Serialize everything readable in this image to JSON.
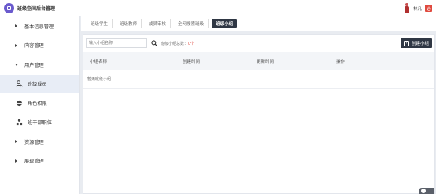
{
  "header": {
    "app_title": "班级空间后台管理",
    "user_name": "林凡"
  },
  "sidebar": {
    "items": [
      {
        "label": "基本信息管理",
        "type": "group",
        "expanded": false
      },
      {
        "label": "内容管理",
        "type": "group",
        "expanded": false
      },
      {
        "label": "用户管理",
        "type": "group",
        "expanded": true
      },
      {
        "label": "班级成员",
        "type": "sub",
        "icon": "user-icon",
        "active": true
      },
      {
        "label": "角色权限",
        "type": "sub",
        "icon": "role-icon",
        "active": false
      },
      {
        "label": "班干部职位",
        "type": "sub",
        "icon": "org-icon",
        "active": false
      },
      {
        "label": "资源管理",
        "type": "group",
        "expanded": false
      },
      {
        "label": "展现管理",
        "type": "group",
        "expanded": false
      }
    ]
  },
  "tabs": [
    {
      "label": "班级学生",
      "active": false
    },
    {
      "label": "班级教师",
      "active": false
    },
    {
      "label": "成员审核",
      "active": false
    },
    {
      "label": "全网搜索班级",
      "active": false
    },
    {
      "label": "班级小组",
      "active": true
    }
  ],
  "toolbar": {
    "search_placeholder": "输入小组名称",
    "count_label": "班级小组总数：",
    "count_value": "0个",
    "create_label": "创建小组"
  },
  "table": {
    "columns": [
      "小组名称",
      "创建时间",
      "更新时间",
      "操作"
    ],
    "empty_text": "暂无班级小组"
  },
  "colors": {
    "accent_dark": "#2f3744",
    "logo": "#6a5acd",
    "danger": "#e04a3f"
  }
}
